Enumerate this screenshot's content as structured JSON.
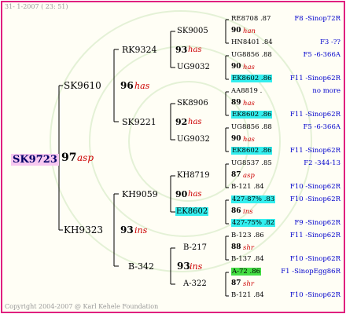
{
  "date": "31- 1-2007 ( 23: 51)",
  "copyright": "Copyright 2004-2007 @ Karl Kehele Foundation",
  "colors": {
    "frame": "#e0207f",
    "breeder": "#cc0000",
    "ref": "#0000cc",
    "highlight_cyan": "#33eeee",
    "highlight_pink": "#f8c8f0",
    "highlight_green": "#44dd44"
  },
  "root": {
    "id": "SK9723",
    "year": "97",
    "breeder": "asp"
  },
  "gen1": [
    {
      "id": "SK9610"
    },
    {
      "id": "KH9323",
      "year": "93",
      "breeder": "ins"
    }
  ],
  "gen2": [
    {
      "id": "RK9324"
    },
    {
      "id": "SK9221",
      "year": "96",
      "breeder": "has"
    },
    {
      "id": "KH9059"
    },
    {
      "id": "B-342",
      "year": "93",
      "breeder": "ins"
    }
  ],
  "gen3": [
    {
      "id": "SK9005"
    },
    {
      "id": "UG9032",
      "year": "93",
      "breeder": "has"
    },
    {
      "id": "SK8906"
    },
    {
      "id": "UG9032",
      "year": "92",
      "breeder": "has"
    },
    {
      "id": "KH8719"
    },
    {
      "id": "EK8602",
      "year": "90",
      "breeder": "has"
    },
    {
      "id": "B-217"
    },
    {
      "id": "A-322",
      "year": "89",
      "breeder": "shr"
    }
  ],
  "gen4": [
    {
      "mother": "RE8708 .87",
      "year": "90",
      "breeder": "han",
      "father": "HN8401 .84",
      "mref": "F8 -Sinop72R",
      "fref": "F3 -??"
    },
    {
      "mother": "UG8856 .88",
      "year": "90",
      "breeder": "has",
      "father": "EK8602 .86",
      "mref": "F5 -6-366A",
      "fref": "F11 -Sinop62R"
    },
    {
      "mother": "AA8819 .",
      "year": "89",
      "breeder": "has",
      "father": "EK8602 .86",
      "mref": "no more",
      "fref": "F11 -Sinop62R"
    },
    {
      "mother": "UG8856 .88",
      "year": "90",
      "breeder": "has",
      "father": "EK8602 .86",
      "mref": "F5 -6-366A",
      "fref": "F11 -Sinop62R"
    },
    {
      "mother": "UG8537 .85",
      "year": "87",
      "breeder": "asp",
      "father": "B-121 .84",
      "mref": "F2 -344-13",
      "fref": "F10 -Sinop62R"
    },
    {
      "mother": "427-87% .83",
      "year": "86",
      "breeder": "ins",
      "father": "427-75% .82",
      "mref": "F10 -Sinop62R",
      "fref": "F9 -Sinop62R"
    },
    {
      "mother": "B-123 .86",
      "year": "88",
      "breeder": "shr",
      "father": "B-137 .84",
      "mref": "F11 -Sinop62R",
      "fref": "F10 -Sinop62R"
    },
    {
      "mother": "A-72 .86",
      "year": "87",
      "breeder": "shr",
      "father": "B-121 .84",
      "mref": "F1 -SinopEgg86R",
      "fref": "F10 -Sinop62R"
    }
  ]
}
